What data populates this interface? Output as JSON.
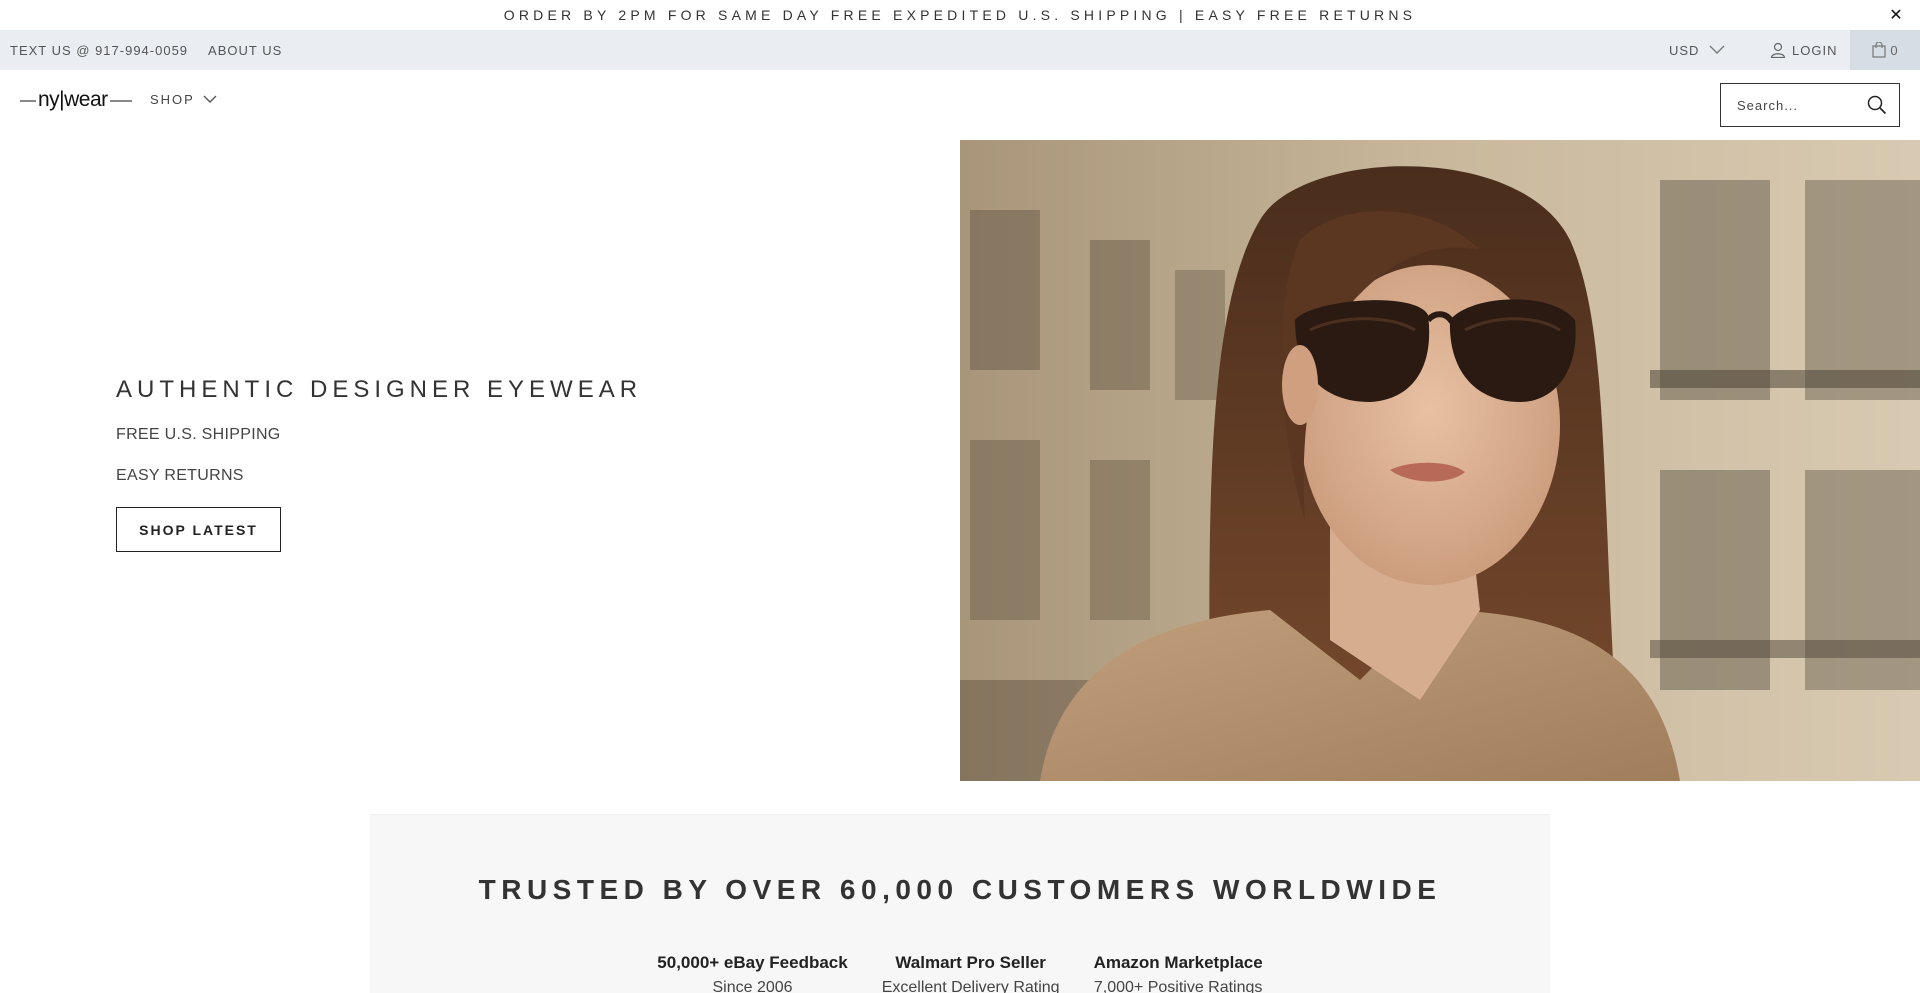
{
  "announcement": {
    "text": "ORDER BY 2PM FOR SAME DAY FREE EXPEDITED U.S. SHIPPING | EASY FREE RETURNS",
    "close_label": "✕"
  },
  "utility_bar": {
    "text_us": "TEXT US @ 917-994-0059",
    "about_us": "ABOUT US",
    "currency": "USD",
    "login": "LOGIN",
    "cart_count": "0"
  },
  "header": {
    "logo_text": "ny|wear",
    "shop_label": "SHOP",
    "search_placeholder": "Search..."
  },
  "hero": {
    "title": "AUTHENTIC DESIGNER EYEWEAR",
    "line1": "FREE U.S. SHIPPING",
    "line2": "EASY RETURNS",
    "button": "SHOP LATEST"
  },
  "trust": {
    "title": "TRUSTED BY OVER 60,000 CUSTOMERS WORLDWIDE",
    "items": [
      {
        "heading": "50,000+ eBay Feedback",
        "sub": "Since 2006"
      },
      {
        "heading": "Walmart Pro Seller",
        "sub": "Excellent Delivery Rating"
      },
      {
        "heading": "Amazon Marketplace",
        "sub": "7,000+ Positive Ratings"
      }
    ]
  },
  "colors": {
    "utility_bg": "#eaeef2",
    "cart_bg": "#d6dde4",
    "trust_bg": "#f7f7f7",
    "text_dark": "#222222"
  },
  "icons": [
    "close-icon",
    "chevron-down-icon",
    "user-icon",
    "bag-icon",
    "search-icon"
  ]
}
